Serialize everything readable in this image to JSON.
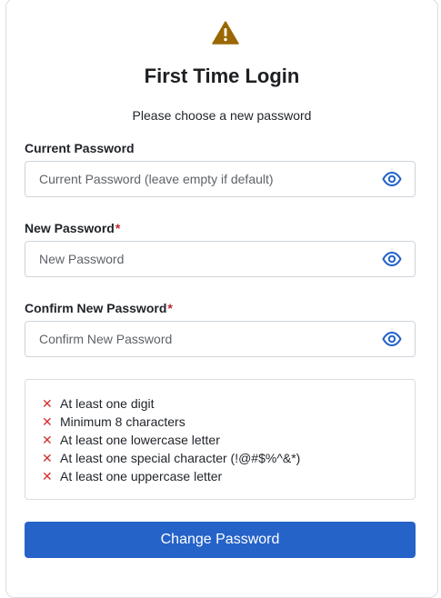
{
  "header": {
    "warning_icon": "warning-triangle-icon",
    "title": "First Time Login",
    "subtitle": "Please choose a new password"
  },
  "form": {
    "current": {
      "label": "Current Password",
      "required": false,
      "placeholder": "Current Password (leave empty if default)",
      "value": ""
    },
    "new": {
      "label": "New Password",
      "required_mark": "*",
      "placeholder": "New Password",
      "value": ""
    },
    "confirm": {
      "label": "Confirm New Password",
      "required_mark": "*",
      "placeholder": "Confirm New Password",
      "value": ""
    }
  },
  "requirements": [
    {
      "text": "At least one digit",
      "met": false
    },
    {
      "text": "Minimum 8 characters",
      "met": false
    },
    {
      "text": "At least one lowercase letter",
      "met": false
    },
    {
      "text": "At least one special character (!@#$%^&*)",
      "met": false
    },
    {
      "text": "At least one uppercase letter",
      "met": false
    }
  ],
  "submit_label": "Change Password",
  "colors": {
    "accent": "#2563c9",
    "warning": "#9a6700",
    "error": "#d32f2f",
    "required": "#c0262d"
  }
}
